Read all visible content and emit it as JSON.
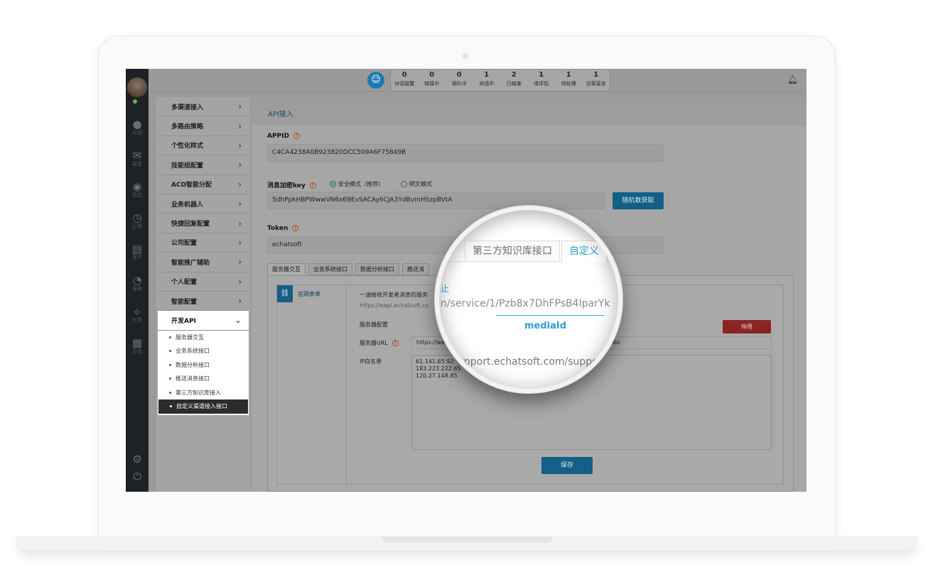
{
  "rail": {
    "items": [
      {
        "icon": "chat-icon",
        "label": "对话"
      },
      {
        "icon": "mail-icon",
        "label": "留言"
      },
      {
        "icon": "eye-icon",
        "label": "监控"
      },
      {
        "icon": "clock-icon",
        "label": "记录"
      },
      {
        "icon": "card-icon",
        "label": "客户"
      },
      {
        "icon": "pie-chart-icon",
        "label": "报表"
      },
      {
        "icon": "share-icon",
        "label": "分享"
      },
      {
        "icon": "clipboard-icon",
        "label": "日志"
      }
    ],
    "settings_icon": "gear-icon",
    "power_icon": "power-icon"
  },
  "topbar": {
    "stats": [
      {
        "count": "0",
        "label": "对话报警"
      },
      {
        "count": "0",
        "label": "转接中"
      },
      {
        "count": "0",
        "label": "排队中"
      },
      {
        "count": "1",
        "label": "对话中"
      },
      {
        "count": "2",
        "label": "已结束"
      },
      {
        "count": "1",
        "label": "待评估"
      },
      {
        "count": "1",
        "label": "待处理"
      },
      {
        "count": "1",
        "label": "访客留言"
      }
    ]
  },
  "menu": {
    "items": [
      "多渠道接入",
      "多路由策略",
      "个性化样式",
      "技能组配置",
      "ACD智能分配",
      "业务机器人",
      "快捷回复配置",
      "公司配置",
      "智能推广辅助",
      "个人配置",
      "智能配置"
    ],
    "open_item": "开发API",
    "sub_items": [
      "服务器交互",
      "业务系统接口",
      "数据分析接口",
      "推送消息接口",
      "第三方知识库接入",
      "自定义渠道接入接口"
    ]
  },
  "main": {
    "breadcrumb": "API接入",
    "appid_label": "APPID",
    "appid_value": "C4CA4238A0B923820DCC509A6F75849B",
    "key_label": "消息加密key",
    "radio_secure": "安全模式（推荐）",
    "radio_plain": "明文模式",
    "key_value": "5dhPpkHBPWwwVN6x69EvSACAy6CJA3YdBvmHSzpBVtA",
    "random_button": "随机数获取",
    "token_label": "Token",
    "token_value": "echatsoft",
    "tabs": [
      "服务器交互",
      "业务系统接口",
      "数据分析接口",
      "推送消"
    ],
    "side_tab": "官网表单",
    "desc_line1": "一油接收开发者消息的服务",
    "desc_line2": "https://eapi.echatsoft.co",
    "server_config_label": "服务器配置",
    "disable_button": "停用",
    "server_url_label": "服务器URL",
    "server_url_value": "https://we",
    "server_url_tail": "do",
    "ip_label": "IP白名单",
    "ip_list": [
      "61.141.65.92",
      "183.223.222.65",
      "120.27.148.85"
    ],
    "save_button": "保存"
  },
  "magnifier": {
    "tab1": "第三方知识库接口",
    "tab2": "自定义",
    "link_fragment": "止",
    "url_fragment": "n/service/1/Pzb8x7DhFPsB4IparYk",
    "media_label": "mediaId",
    "support_fragment": "upport.echatsoft.com/suppo"
  }
}
